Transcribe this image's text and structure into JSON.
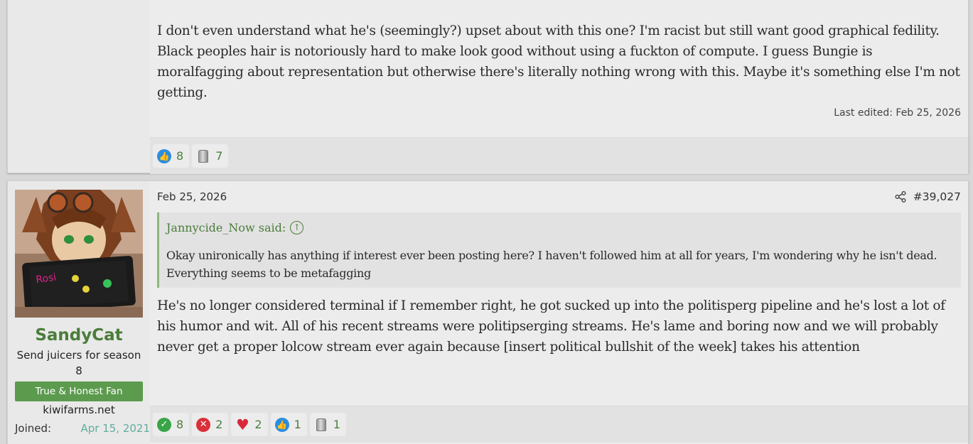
{
  "post1": {
    "body": "I don't even understand what he's (seemingly?) upset about with this one? I'm racist but still want good graphical fedility. Black peoples hair is notoriously hard to make look good without using a fuckton of compute. I guess Bungie is moralfagging about representation but otherwise there's literally nothing wrong with this. Maybe it's something else I'm not getting.",
    "last_edited": "Last edited: Feb 25, 2026",
    "reactions": [
      {
        "icon": "like-icon",
        "count": "8"
      },
      {
        "icon": "can-icon",
        "count": "7"
      }
    ]
  },
  "post2": {
    "user": {
      "name": "SandyCat",
      "title": "Send juicers for season 8",
      "banner": "True & Honest Fan",
      "site": "kiwifarms.net",
      "joined_label": "Joined:",
      "joined_value": "Apr 15, 2021"
    },
    "date": "Feb 25, 2026",
    "number": "#39,027",
    "quote": {
      "author": "Jannycide_Now said:",
      "body": "Okay unironically has anything if interest ever been posting here? I haven't followed him at all for years, I'm wondering why he isn't dead. Everything seems to be metafagging"
    },
    "body": "He's no longer considered terminal if I remember right, he got sucked up into the politisperg pipeline and he's lost a lot of his humor and wit. All of his recent streams were politipserging streams. He's lame and boring now and we will probably never get a proper lolcow stream ever again because [insert political bullshit of the week] takes his attention",
    "reactions": [
      {
        "icon": "check-icon",
        "count": "8"
      },
      {
        "icon": "x-icon",
        "count": "2"
      },
      {
        "icon": "heart-icon",
        "count": "2"
      },
      {
        "icon": "like-icon",
        "count": "1"
      },
      {
        "icon": "can-icon",
        "count": "1"
      }
    ]
  }
}
